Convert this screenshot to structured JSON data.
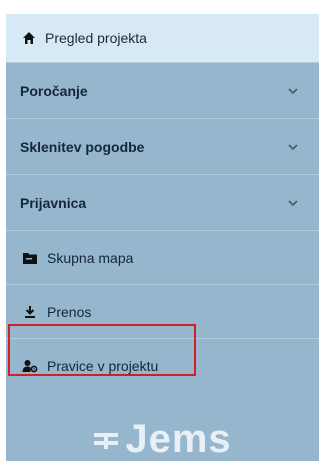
{
  "sidebar": {
    "top_item": {
      "label": "Pregled projekta",
      "icon": "home-icon"
    },
    "sections": [
      {
        "label": "Poročanje",
        "icon": "chevron-down-icon"
      },
      {
        "label": "Sklenitev pogodbe",
        "icon": "chevron-down-icon"
      },
      {
        "label": "Prijavnica",
        "icon": "chevron-down-icon"
      }
    ],
    "links": [
      {
        "label": "Skupna mapa",
        "icon": "folder-icon"
      },
      {
        "label": "Prenos",
        "icon": "download-icon"
      },
      {
        "label": "Pravice v projektu",
        "icon": "user-settings-icon"
      }
    ],
    "logo_text": "Jems"
  },
  "colors": {
    "sidebar_bg": "#95b6cd",
    "top_item_bg": "#d7e9f5",
    "text": "#13273a",
    "highlight": "#d02027",
    "logo": "#e8f0f6"
  }
}
